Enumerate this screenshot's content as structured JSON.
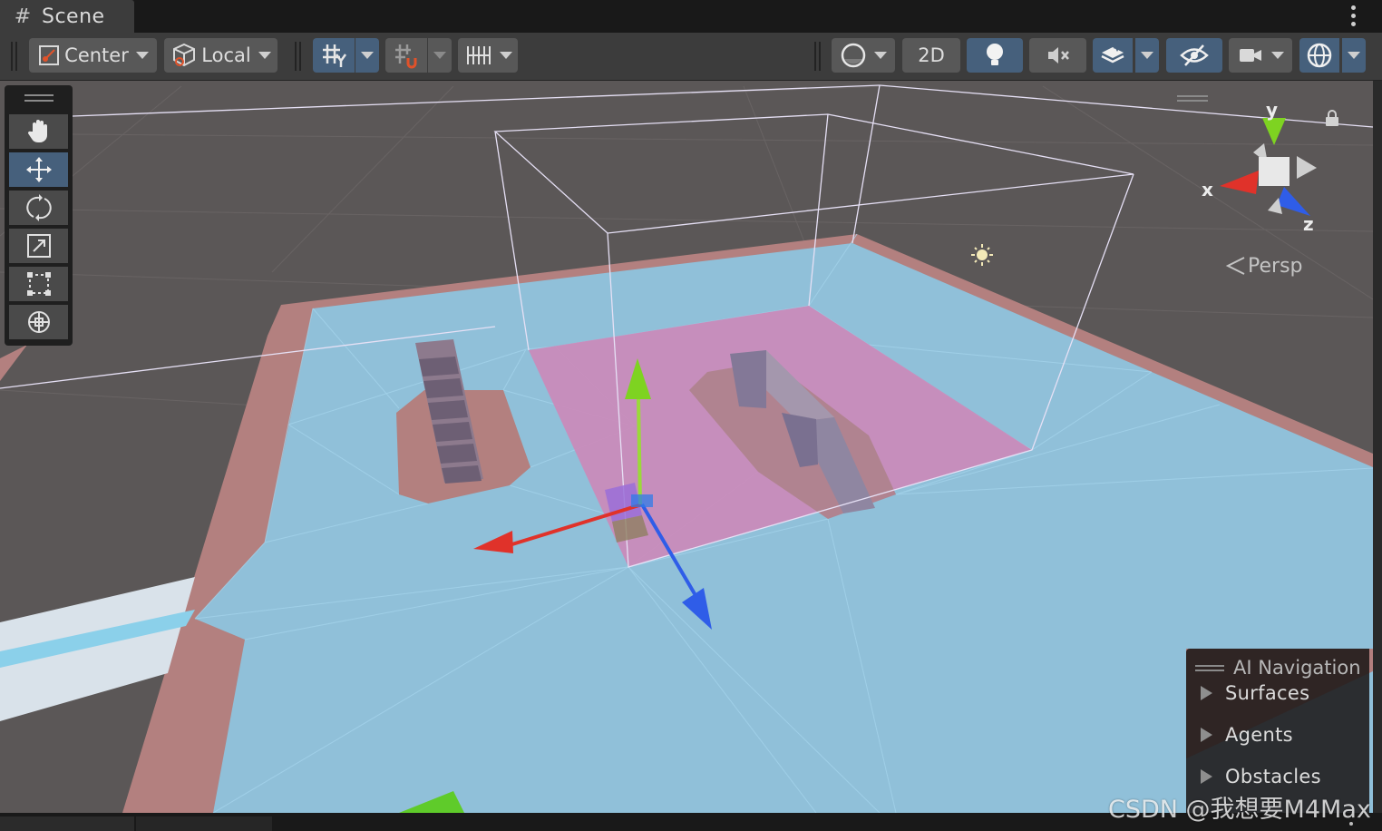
{
  "tab": {
    "title": "Scene"
  },
  "toolbar": {
    "pivot_mode": "Center",
    "pivot_rotation": "Local",
    "view_2d": "2D"
  },
  "gizmo": {
    "x_label": "x",
    "y_label": "y",
    "z_label": "z",
    "projection": "Persp"
  },
  "overlay": {
    "title": "AI Navigation",
    "items": [
      "Surfaces",
      "Agents",
      "Obstacles"
    ]
  },
  "watermark": "CSDN @我想要M4Max",
  "colors": {
    "tab_bg": "#3c3c3c",
    "toolbar_bg": "#3c3c3c",
    "button_bg": "#585858",
    "button_active": "#46607c",
    "navmesh": "#8fc3dd",
    "obstacle_area": "#c98bbb",
    "ground_border": "#b88a88",
    "axis_x": "#e0322a",
    "axis_y": "#7ed321",
    "axis_z": "#2f5de8"
  }
}
